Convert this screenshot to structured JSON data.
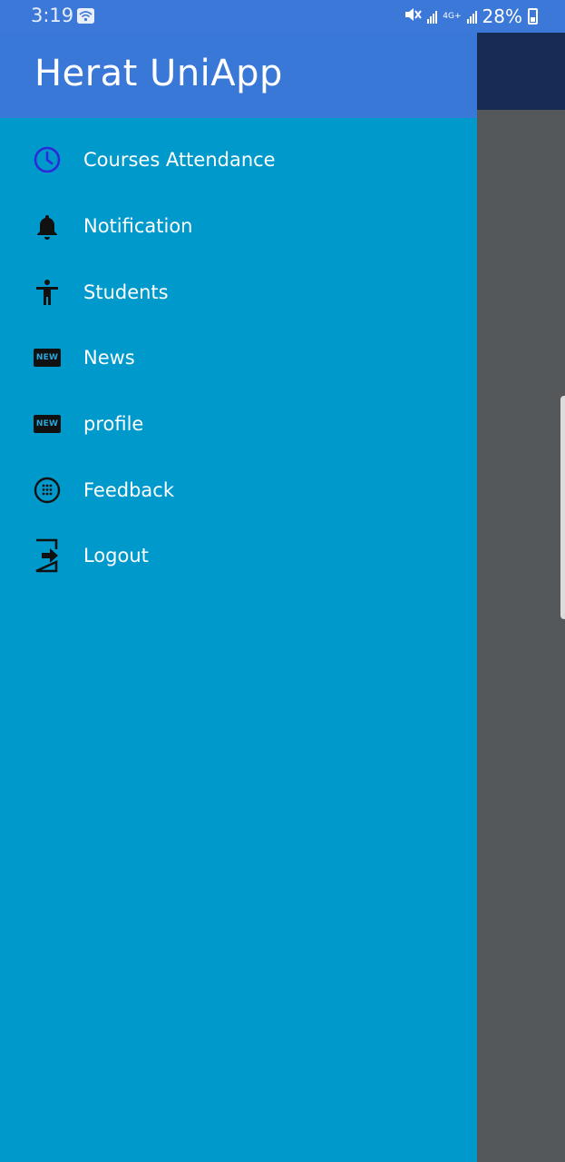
{
  "status_bar": {
    "time": "3:19",
    "battery": "28%",
    "network": "4G+"
  },
  "drawer": {
    "title": "Herat UniApp",
    "items": [
      {
        "label": "Courses Attendance",
        "icon": "clock-icon"
      },
      {
        "label": "Notification",
        "icon": "bell-icon"
      },
      {
        "label": "Students",
        "icon": "accessibility-icon"
      },
      {
        "label": "News",
        "icon": "new-badge-icon",
        "badge": "NEW"
      },
      {
        "label": "profile",
        "icon": "new-badge-icon",
        "badge": "NEW"
      },
      {
        "label": "Feedback",
        "icon": "dialpad-icon"
      },
      {
        "label": "Logout",
        "icon": "logout-icon"
      }
    ]
  },
  "colors": {
    "status_bar": "#3c78d8",
    "drawer_header": "#3a78d8",
    "drawer_body": "#0099cc",
    "background_toolbar": "#172b54",
    "background_scrim": "#55585b"
  }
}
